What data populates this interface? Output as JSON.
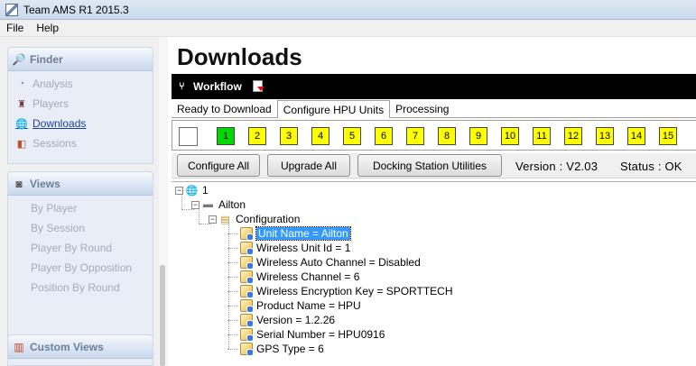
{
  "window": {
    "title": "Team AMS R1 2015.3"
  },
  "menu": [
    "File",
    "Help"
  ],
  "sidebar": {
    "finder": {
      "title": "Finder",
      "items": [
        {
          "label": "Analysis",
          "icon": "analysis-icon"
        },
        {
          "label": "Players",
          "icon": "players-icon"
        },
        {
          "label": "Downloads",
          "icon": "downloads-icon",
          "active": true
        },
        {
          "label": "Sessions",
          "icon": "sessions-icon"
        }
      ]
    },
    "views": {
      "title": "Views",
      "items": [
        "By Player",
        "By Session",
        "Player By Round",
        "Player By Opposition",
        "Position By Round"
      ]
    },
    "custom_views": {
      "title": "Custom Views"
    }
  },
  "page": {
    "title": "Downloads"
  },
  "workflow": {
    "label": "Workflow"
  },
  "tabs": [
    "Ready to Download",
    "Configure HPU Units",
    "Processing"
  ],
  "units": [
    "1",
    "2",
    "3",
    "4",
    "5",
    "6",
    "7",
    "8",
    "9",
    "10",
    "11",
    "12",
    "13",
    "14",
    "15"
  ],
  "toolbar": {
    "configure_all": "Configure All",
    "upgrade_all": "Upgrade All",
    "docking_utils": "Docking Station Utilities",
    "version": "Version : V2.03",
    "status": "Status : OK"
  },
  "tree": {
    "root": "1",
    "device": "Ailton",
    "group": "Configuration",
    "properties": [
      "Unit Name = Ailton",
      "Wireless Unit Id = 1",
      "Wireless Auto Channel = Disabled",
      "Wireless Channel = 6",
      "Wireless Encryption Key = SPORTTECH",
      "Product Name = HPU",
      "Version = 1.2.26",
      "Serial Number = HPU0916",
      "GPS Type = 6"
    ]
  },
  "colors": {
    "active_unit": "#00d900",
    "unit": "#ffff00",
    "selection": "#3399ff"
  }
}
